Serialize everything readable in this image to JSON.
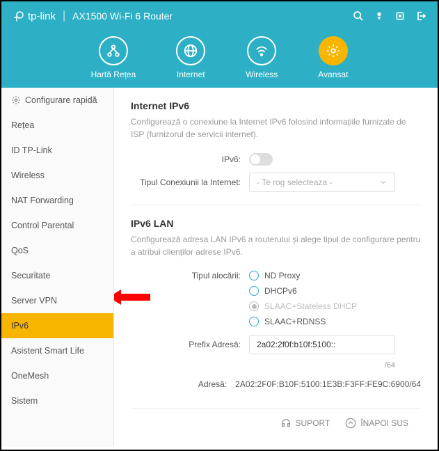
{
  "header": {
    "brand": "tp-link",
    "product": "AX1500 Wi-Fi 6 Router"
  },
  "nav": {
    "items": [
      {
        "label": "Hartă Rețea"
      },
      {
        "label": "Internet"
      },
      {
        "label": "Wireless"
      },
      {
        "label": "Avansat"
      }
    ]
  },
  "sidebar": {
    "items": [
      "Configurare rapidă",
      "Rețea",
      "ID TP-Link",
      "Wireless",
      "NAT Forwarding",
      "Control Parental",
      "QoS",
      "Securitate",
      "Server VPN",
      "IPv6",
      "Asistent Smart Life",
      "OneMesh",
      "Sistem"
    ]
  },
  "main": {
    "section1": {
      "title": "Internet IPv6",
      "desc": "Configurează o conexiune la Internet IPv6 folosind informațiile furnizate de ISP (furnizorul de servicii internet).",
      "ipv6_label": "IPv6:",
      "conn_label": "Tipul Conexiunii la Internet:",
      "conn_placeholder": "- Te rog selecteaza -"
    },
    "section2": {
      "title": "IPv6 LAN",
      "desc": "Configurează adresa LAN IPv6 a routerului și alege tipul de configurare pentru a atribui clienților adrese IPv6.",
      "alloc_label": "Tipul alocării:",
      "options": [
        "ND Proxy",
        "DHCPv6",
        "SLAAC+Stateless DHCP",
        "SLAAC+RDNSS"
      ],
      "prefix_label": "Prefix Adresă:",
      "prefix_value": "2a02:2f0f:b10f:5100::",
      "prefix_suffix": "/64",
      "addr_label": "Adresă:",
      "addr_value": "2A02:2F0F:B10F:5100:1E3B:F3FF:FE9C:6900/64"
    }
  },
  "footer": {
    "support": "SUPORT",
    "top": "ÎNAPOI SUS"
  }
}
